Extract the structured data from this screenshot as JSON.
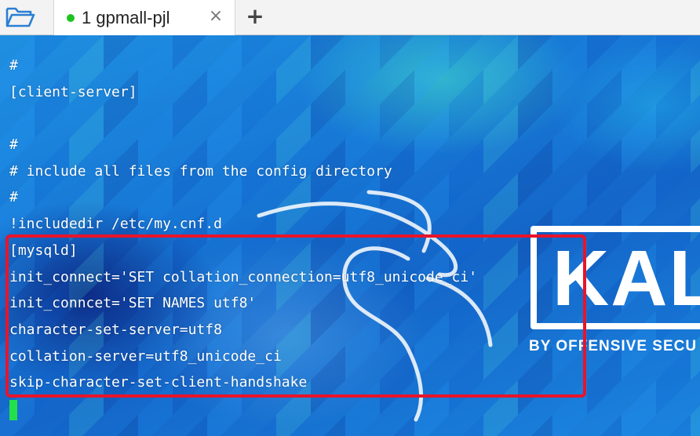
{
  "tabbar": {
    "open_folder_icon": "folder-open-icon",
    "tab": {
      "status_color": "#1ec21e",
      "title": "1 gpmall-pjl",
      "close_icon": "×"
    },
    "new_tab_icon": "+"
  },
  "wallpaper": {
    "logo_text": "KAL",
    "logo_subtitle": "BY OFFENSIVE SECU"
  },
  "terminal": {
    "lines": [
      "#",
      "[client-server]",
      "",
      "#",
      "# include all files from the config directory",
      "#",
      "!includedir /etc/my.cnf.d",
      "[mysqld]",
      "init_connect='SET collation_connection=utf8_unicode_ci'",
      "init_conncet='SET NAMES utf8'",
      "character-set-server=utf8",
      "collation-server=utf8_unicode_ci",
      "skip-character-set-client-handshake"
    ],
    "highlight_color": "#e8142a",
    "cursor_color": "#22e04a"
  }
}
